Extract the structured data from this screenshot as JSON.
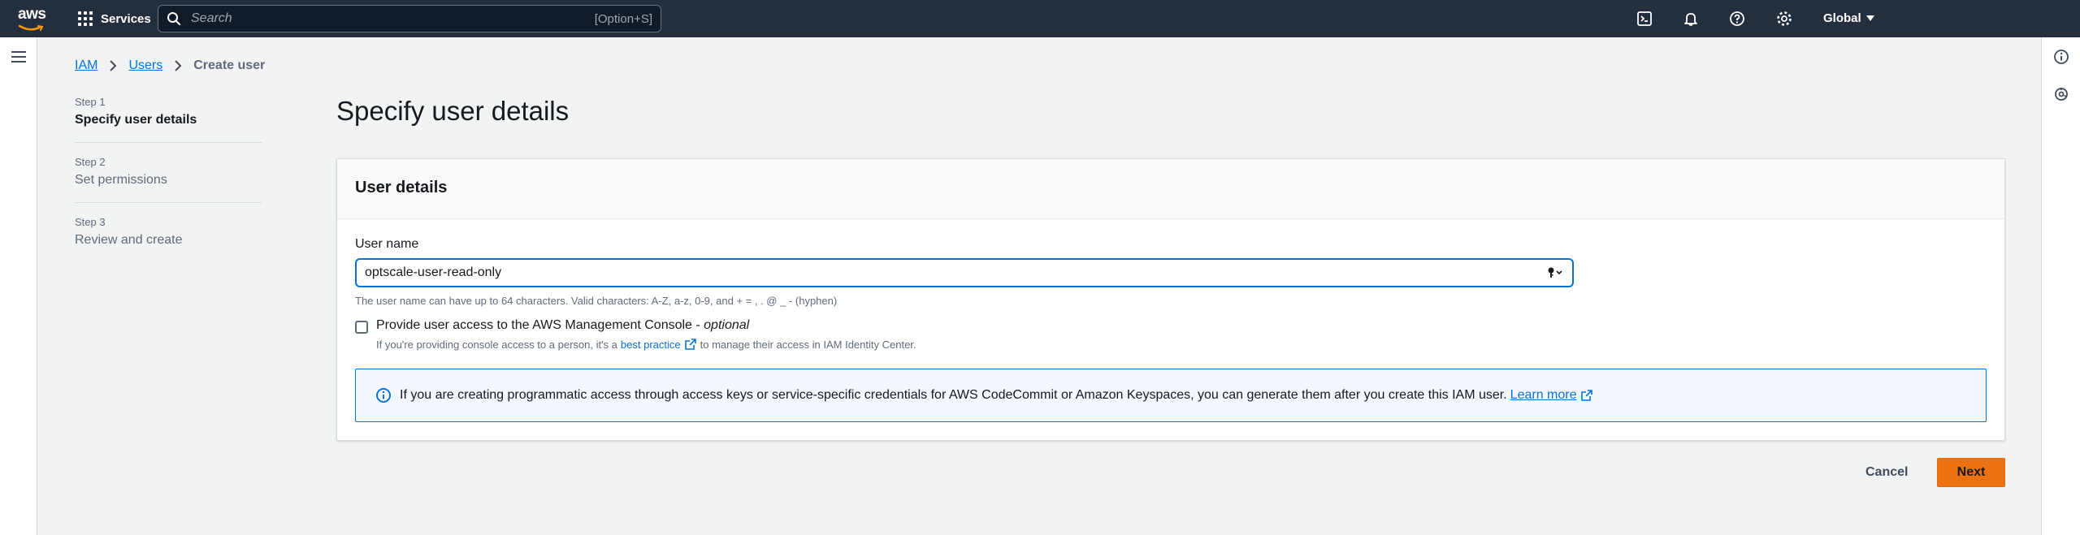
{
  "topnav": {
    "logo_text": "aws",
    "services_label": "Services",
    "search_placeholder": "Search",
    "search_shortcut": "[Option+S]",
    "region_label": "Global",
    "icons": [
      "cloudshell-icon",
      "bell-icon",
      "help-icon",
      "gear-icon"
    ]
  },
  "breadcrumb": {
    "items": [
      "IAM",
      "Users"
    ],
    "current": "Create user"
  },
  "steps": [
    {
      "num": "Step 1",
      "name": "Specify user details",
      "active": true
    },
    {
      "num": "Step 2",
      "name": "Set permissions",
      "active": false
    },
    {
      "num": "Step 3",
      "name": "Review and create",
      "active": false
    }
  ],
  "page_title": "Specify user details",
  "panel": {
    "title": "User details",
    "user_name_label": "User name",
    "user_name_value": "optscale-user-read-only",
    "constraint_text": "The user name can have up to 64 characters. Valid characters: A-Z, a-z, 0-9, and + = , . @ _ - (hyphen)",
    "console_access_label": "Provide user access to the AWS Management Console - ",
    "console_access_optional": "optional",
    "console_access_checked": false,
    "console_desc_before": "If you're providing console access to a person, it's a",
    "console_desc_link": "best practice",
    "console_desc_after": "to manage their access in IAM Identity Center.",
    "info_text": "If you are creating programmatic access through access keys or service-specific credentials for AWS CodeCommit or Amazon Keyspaces, you can generate them after you create this IAM user.",
    "info_link": "Learn more"
  },
  "footer": {
    "cancel_label": "Cancel",
    "next_label": "Next"
  },
  "colors": {
    "nav_bg": "#232f3e",
    "link": "#0972d3",
    "primary_button": "#ec7211",
    "page_bg": "#f2f3f3"
  }
}
